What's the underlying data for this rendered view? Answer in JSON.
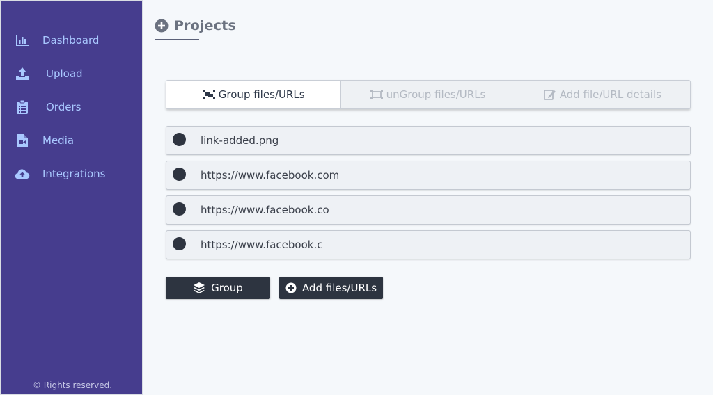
{
  "sidebar": {
    "items": [
      {
        "label": "Dashboard",
        "icon": "chart-bar-icon"
      },
      {
        "label": "Upload",
        "icon": "upload-icon"
      },
      {
        "label": "Orders",
        "icon": "clipboard-list-icon"
      },
      {
        "label": "Media",
        "icon": "file-video-icon"
      },
      {
        "label": "Integrations",
        "icon": "cloud-upload-icon"
      }
    ],
    "footer": "© Rights reserved."
  },
  "header": {
    "title": "Projects",
    "icon": "plus-circle-icon"
  },
  "tabs": [
    {
      "label": "Group files/URLs",
      "icon": "object-group-icon",
      "active": true
    },
    {
      "label": "unGroup files/URLs",
      "icon": "object-ungroup-icon",
      "active": false
    },
    {
      "label": "Add file/URL details",
      "icon": "edit-icon",
      "active": false
    }
  ],
  "items": [
    {
      "text": "link-added.png"
    },
    {
      "text": "https://www.facebook.com"
    },
    {
      "text": "https://www.facebook.co"
    },
    {
      "text": "https://www.facebook.c"
    }
  ],
  "buttons": {
    "group_label": "Group",
    "add_label": "Add files/URLs"
  },
  "colors": {
    "sidebar_bg": "#463d8e",
    "sidebar_text": "#a9c8ff",
    "button_bg": "#2d3440",
    "page_bg": "#f5f8fb"
  }
}
